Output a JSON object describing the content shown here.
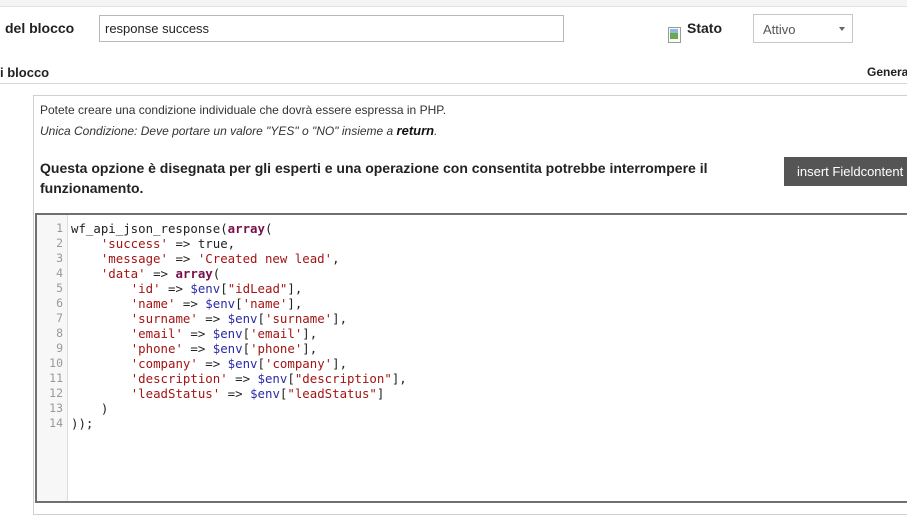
{
  "form": {
    "name_label": "del blocco",
    "name_value": "response success",
    "stato_label": "Stato",
    "stato_value": "Attivo",
    "section_label": "i blocco",
    "tab_general": "General"
  },
  "panel": {
    "info_line1": "Potete creare una condizione individuale che dovrà essere espressa in PHP.",
    "info_line2_prefix": "Unica Condizione: Deve portare un valore \"YES\" o \"NO\" insieme a ",
    "info_line2_keyword": "return",
    "info_line2_suffix": ".",
    "warning": "Questa opzione è disegnata per gli esperti e una operazione con consentita potrebbe interrompere il funzionamento.",
    "insert_button": "insert Fieldcontent"
  },
  "editor": {
    "lines": [
      {
        "n": "1",
        "code": "wf_api_json_response(array("
      },
      {
        "n": "2",
        "code": "    'success' => true,"
      },
      {
        "n": "3",
        "code": "    'message' => 'Created new lead',"
      },
      {
        "n": "4",
        "code": "    'data' => array("
      },
      {
        "n": "5",
        "code": "        'id' => $env[\"idLead\"],"
      },
      {
        "n": "6",
        "code": "        'name' => $env['name'],"
      },
      {
        "n": "7",
        "code": "        'surname' => $env['surname'],"
      },
      {
        "n": "8",
        "code": "        'email' => $env['email'],"
      },
      {
        "n": "9",
        "code": "        'phone' => $env['phone'],"
      },
      {
        "n": "10",
        "code": "        'company' => $env['company'],"
      },
      {
        "n": "11",
        "code": "        'description' => $env[\"description\"],"
      },
      {
        "n": "12",
        "code": "        'leadStatus' => $env[\"leadStatus\"]"
      },
      {
        "n": "13",
        "code": "    )"
      },
      {
        "n": "14",
        "code": "));"
      }
    ]
  },
  "icons": {
    "stato_icon": "broken-image-icon",
    "select_arrow": "chevron-down-icon"
  }
}
